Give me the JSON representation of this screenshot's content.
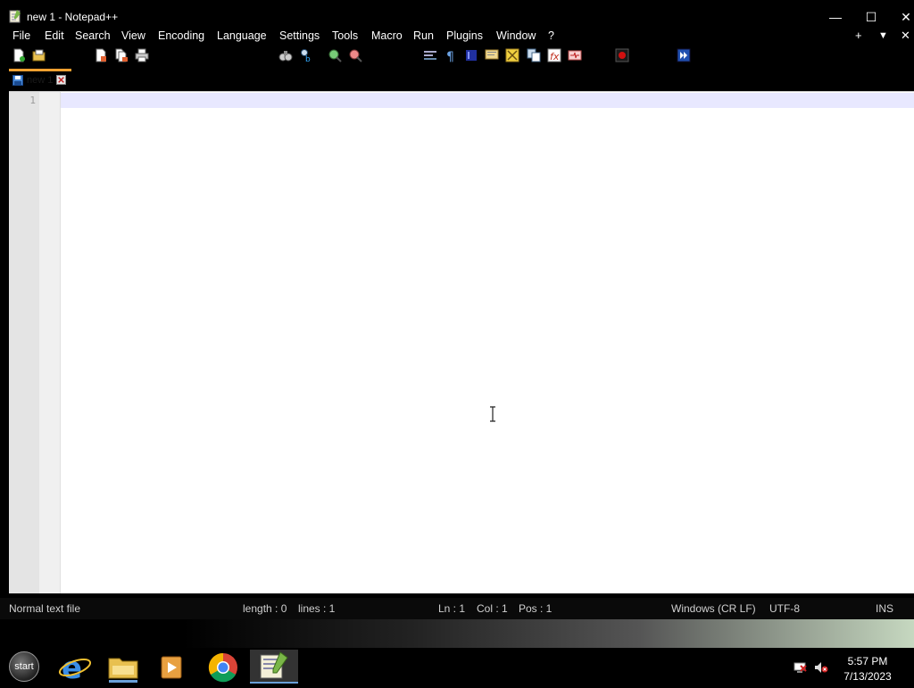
{
  "window": {
    "title": "new 1 - Notepad++",
    "minimize_glyph": "—",
    "maximize_glyph": "☐",
    "close_glyph": "✕"
  },
  "menu": {
    "items": [
      "File",
      "Edit",
      "Search",
      "View",
      "Encoding",
      "Language",
      "Settings",
      "Tools",
      "Macro",
      "Run",
      "Plugins",
      "Window",
      "?"
    ],
    "right": {
      "plus": "+",
      "dropdown": "▼",
      "close": "✕"
    }
  },
  "tab": {
    "label": "new 1"
  },
  "editor": {
    "line_number": "1"
  },
  "status": {
    "file_type": "Normal text file",
    "length": "length : 0",
    "lines": "lines : 1",
    "ln": "Ln : 1",
    "col": "Col : 1",
    "pos": "Pos : 1",
    "eol": "Windows (CR LF)",
    "encoding": "UTF-8",
    "mode": "INS"
  },
  "taskbar": {
    "start_label": "start",
    "clock_time": "5:57 PM",
    "clock_date": "7/13/2023"
  },
  "colors": {
    "tab_accent": "#f0a030",
    "current_line": "#e8e8ff",
    "record_macro": "#d01010"
  }
}
